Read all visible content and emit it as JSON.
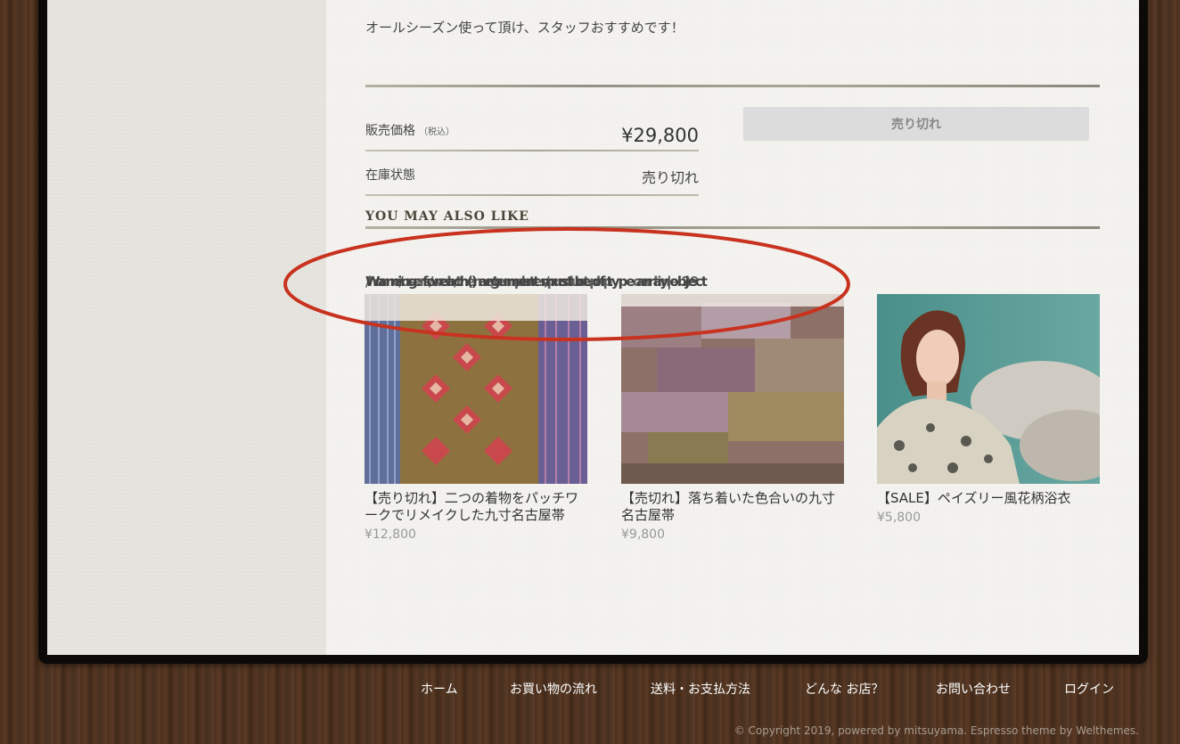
{
  "product": {
    "description": "オールシーズン使って頂け、スタッフおすすめです！",
    "price_label": "販売価格",
    "price_tax_note": "（税込）",
    "price_value": "¥29,800",
    "stock_label": "在庫状態",
    "stock_value": "売り切れ",
    "soldout_button": "売り切れ"
  },
  "related": {
    "title": "YOU MAY ALSO LIKE",
    "garbled_text": [
      "Warning: foreach() argument must be of type array|object",
      "/home/users/web/theme/templates/product.php",
      "on line 29"
    ],
    "items": [
      {
        "title": "【売り切れ】二つの着物をパッチワークでリメイクした九寸名古屋帯",
        "price": "¥12,800"
      },
      {
        "title": "【売切れ】落ち着いた色合いの九寸名古屋帯",
        "price": "¥9,800"
      },
      {
        "title": "【SALE】ペイズリー風花柄浴衣",
        "price": "¥5,800"
      }
    ]
  },
  "annotation": {
    "color": "#c8321e"
  },
  "footer": {
    "nav": [
      "ホーム",
      "お買い物の流れ",
      "送料・お支払方法",
      "どんな お店？",
      "お問い合わせ",
      "ログイン"
    ],
    "copyright": "© Copyright 2019, powered by mitsuyama. Espresso theme by Welthemes."
  }
}
